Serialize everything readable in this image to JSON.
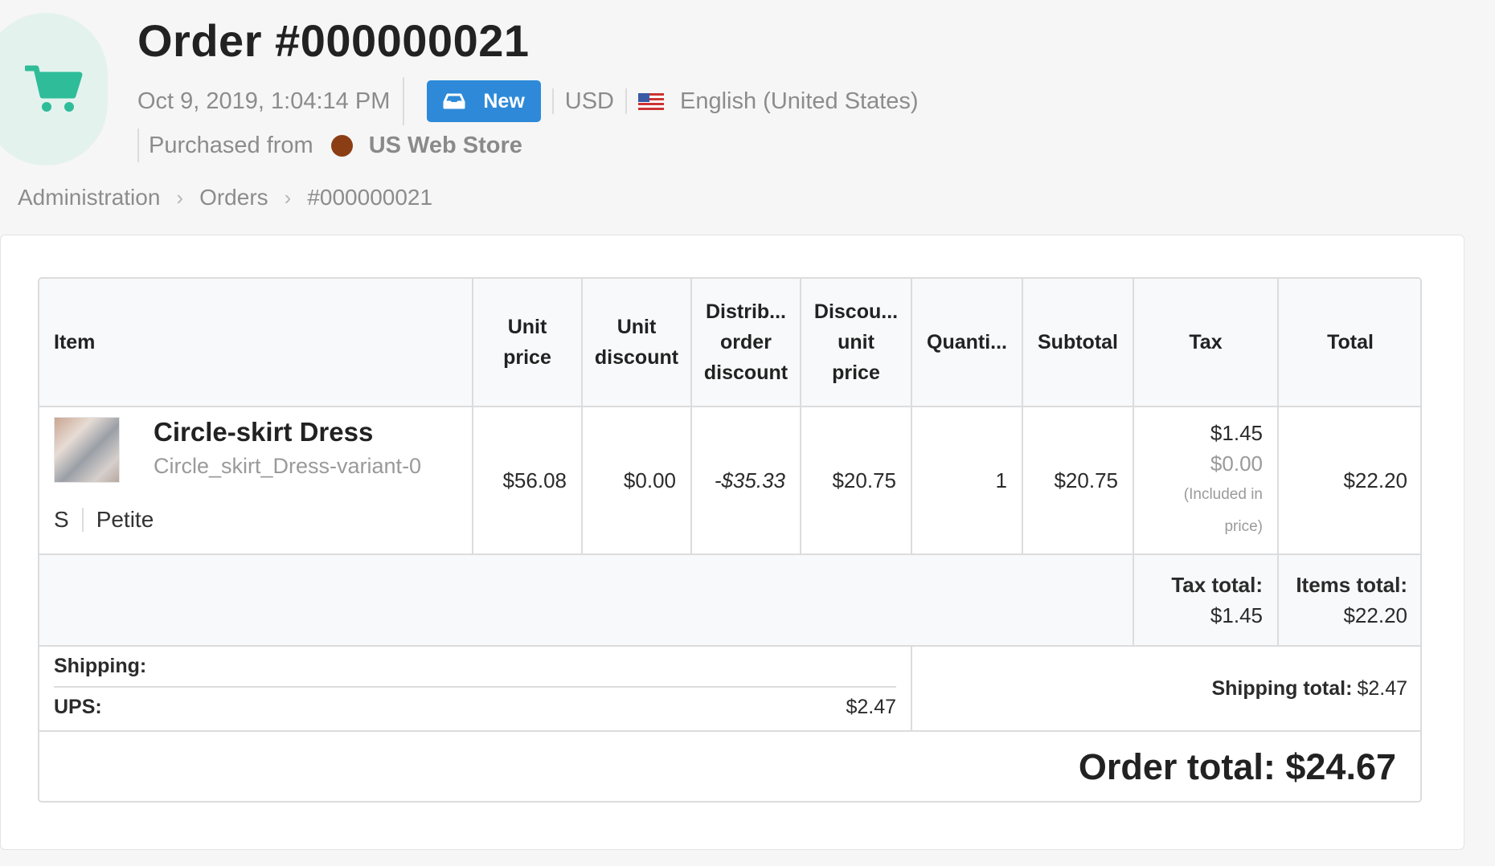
{
  "header": {
    "title": "Order #000000021",
    "date": "Oct 9, 2019, 1:04:14 PM",
    "status_label": "New",
    "currency": "USD",
    "language": "English (United States)",
    "purchased_from_label": "Purchased from",
    "store_name": "US Web Store",
    "store_color": "#8b3e14",
    "accent_color": "#2e8ad8",
    "cart_icon_color": "#2ebd98"
  },
  "breadcrumb": [
    "Administration",
    "Orders",
    "#000000021"
  ],
  "table": {
    "columns": [
      "Item",
      "Unit price",
      "Unit discount",
      "Distrib... order discount",
      "Discou... unit price",
      "Quanti...",
      "Subtotal",
      "Tax",
      "Total"
    ],
    "columns_lines": [
      [
        "Item"
      ],
      [
        "Unit",
        "price"
      ],
      [
        "Unit",
        "discount"
      ],
      [
        "Distrib...",
        "order",
        "discount"
      ],
      [
        "Discou...",
        "unit",
        "price"
      ],
      [
        "Quanti..."
      ],
      [
        "Subtotal"
      ],
      [
        "Tax"
      ],
      [
        "Total"
      ]
    ],
    "items": [
      {
        "name": "Circle-skirt Dress",
        "sku": "Circle_skirt_Dress-variant-0",
        "option_size": "S",
        "option_fit": "Petite",
        "unit_price": "$56.08",
        "unit_discount": "$0.00",
        "distributed_order_discount": "-$35.33",
        "discounted_unit_price": "$20.75",
        "quantity": "1",
        "subtotal": "$20.75",
        "tax": "$1.45",
        "tax_included": "$0.00",
        "tax_note_1": "(Included in",
        "tax_note_2": "price)",
        "total": "$22.20"
      }
    ],
    "tax_total_label": "Tax total:",
    "tax_total_value": "$1.45",
    "items_total_label": "Items total:",
    "items_total_value": "$22.20",
    "shipping_label": "Shipping:",
    "shipping_carrier": "UPS:",
    "shipping_carrier_value": "$2.47",
    "shipping_total_label": "Shipping total:",
    "shipping_total_value": "$2.47",
    "order_total": "Order total: $24.67"
  }
}
